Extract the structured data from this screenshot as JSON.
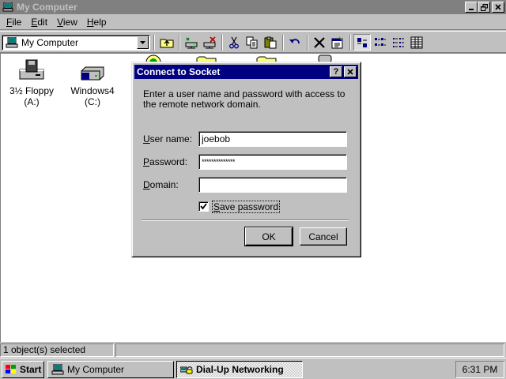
{
  "window": {
    "title": "My Computer",
    "menu": [
      {
        "label": "File",
        "accel": "F",
        "rest": "ile"
      },
      {
        "label": "Edit",
        "accel": "E",
        "rest": "dit"
      },
      {
        "label": "View",
        "accel": "V",
        "rest": "iew"
      },
      {
        "label": "Help",
        "accel": "H",
        "rest": "elp"
      }
    ],
    "address": "My Computer",
    "toolbar_icons": [
      "up-one-level-icon",
      "map-network-drive-icon",
      "disconnect-drive-icon",
      "cut-icon",
      "copy-icon",
      "paste-icon",
      "undo-icon",
      "delete-icon",
      "properties-icon",
      "large-icons-view-icon",
      "small-icons-view-icon",
      "list-view-icon",
      "details-view-icon"
    ]
  },
  "drives": [
    {
      "label": "3½ Floppy (A:)",
      "icon": "floppy-drive-icon"
    },
    {
      "label": "Windows4 (C:)",
      "icon": "hard-drive-icon"
    }
  ],
  "status": {
    "selection": "1 object(s) selected",
    "secondary": ""
  },
  "dialog": {
    "title": "Connect to Socket",
    "description": "Enter a user name and password with access to the remote network domain.",
    "username_label_accel": "U",
    "username_label_rest": "ser name:",
    "username_value": "joebob",
    "password_label_accel": "P",
    "password_label_rest": "assword:",
    "password_value": "**************",
    "domain_label_accel": "D",
    "domain_label_rest": "omain:",
    "domain_value": "",
    "save_password_accel": "S",
    "save_password_rest": "ave password",
    "save_password_checked": true,
    "ok_label": "OK",
    "cancel_label": "Cancel",
    "help_button": "?",
    "close_button": "X"
  },
  "taskbar": {
    "start_label": "Start",
    "tasks": [
      {
        "label": "My Computer",
        "active": false
      },
      {
        "label": "Dial-Up Networking",
        "active": true
      }
    ],
    "clock": "6:31 PM"
  },
  "colors": {
    "desktop_gray": "#c0c0c0",
    "active_title": "#000080",
    "inactive_title": "#808080"
  }
}
